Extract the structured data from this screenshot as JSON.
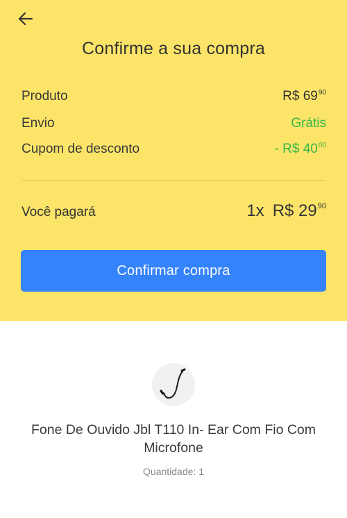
{
  "header": {
    "back_icon": "arrow-left-icon",
    "title": "Confirme a sua compra"
  },
  "summary": {
    "product": {
      "label": "Produto",
      "currency": "R$",
      "price_int": "69",
      "price_cents": "90"
    },
    "shipping": {
      "label": "Envio",
      "value": "Grátis",
      "color": "#39b54a"
    },
    "coupon": {
      "label": "Cupom de desconto",
      "prefix": "- R$",
      "price_int": "40",
      "price_cents": "00",
      "color": "#39b54a"
    }
  },
  "total": {
    "label": "Você pagará",
    "quantity": "1x",
    "currency": "R$",
    "price_int": "29",
    "price_cents": "90"
  },
  "confirm_button": {
    "label": "Confirmar compra",
    "color": "#3483fa"
  },
  "item": {
    "image_icon": "earphone-cable-image",
    "name": "Fone De Ouvido Jbl T110 In- Ear Com Fio Com Microfone",
    "quantity_text": "Quantidade: 1"
  },
  "colors": {
    "header_bg": "#fbe468",
    "accent_green": "#39b54a",
    "button_blue": "#3483fa"
  }
}
